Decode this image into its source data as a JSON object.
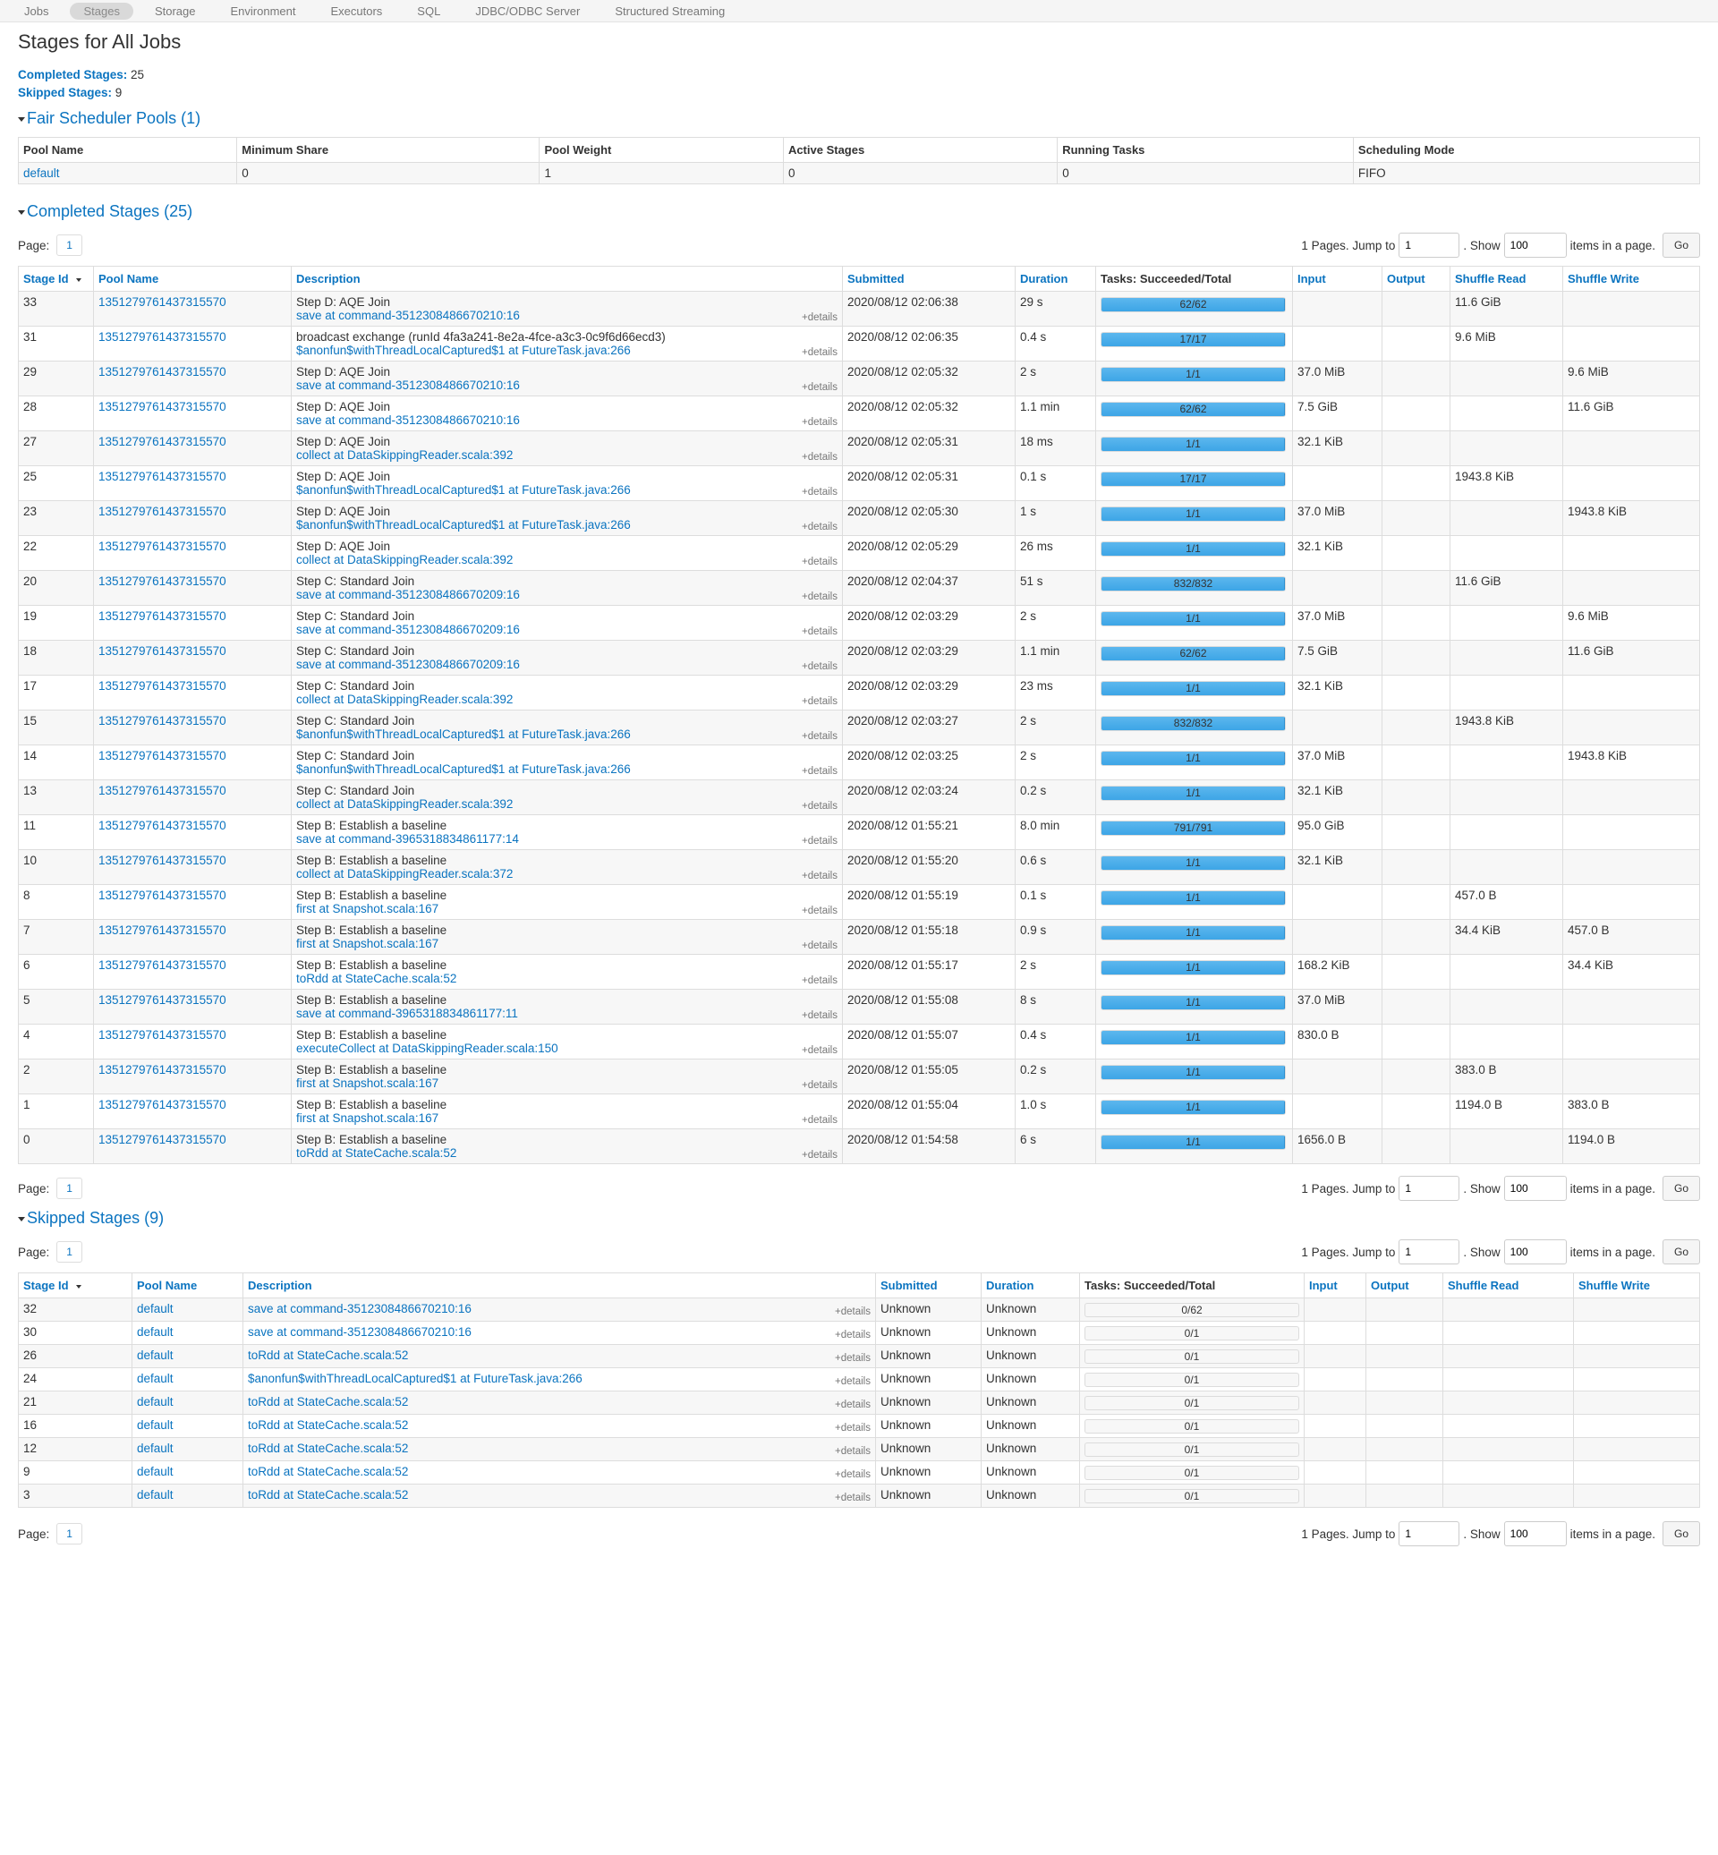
{
  "nav": {
    "tabs": [
      {
        "label": "Jobs",
        "active": false
      },
      {
        "label": "Stages",
        "active": true
      },
      {
        "label": "Storage",
        "active": false
      },
      {
        "label": "Environment",
        "active": false
      },
      {
        "label": "Executors",
        "active": false
      },
      {
        "label": "SQL",
        "active": false
      },
      {
        "label": "JDBC/ODBC Server",
        "active": false
      },
      {
        "label": "Structured Streaming",
        "active": false
      }
    ]
  },
  "page": {
    "title": "Stages for All Jobs",
    "completed_label": "Completed Stages:",
    "completed_count": "25",
    "skipped_label": "Skipped Stages:",
    "skipped_count": "9"
  },
  "pools": {
    "title": "Fair Scheduler Pools (1)",
    "headers": [
      "Pool Name",
      "Minimum Share",
      "Pool Weight",
      "Active Stages",
      "Running Tasks",
      "Scheduling Mode"
    ],
    "rows": [
      {
        "name": "default",
        "min_share": "0",
        "weight": "1",
        "active": "0",
        "running": "0",
        "mode": "FIFO"
      }
    ]
  },
  "pager": {
    "page_label": "Page:",
    "page_num": "1",
    "pages_text": "1 Pages. Jump to",
    "jump_value": "1",
    "show_label": ". Show",
    "show_value": "100",
    "items_text": "items in a page.",
    "go_label": "Go"
  },
  "completed": {
    "title": "Completed Stages (25)",
    "headers": {
      "stage_id": "Stage Id",
      "pool": "Pool Name",
      "desc": "Description",
      "submitted": "Submitted",
      "duration": "Duration",
      "tasks": "Tasks: Succeeded/Total",
      "input": "Input",
      "output": "Output",
      "shuffle_read": "Shuffle Read",
      "shuffle_write": "Shuffle Write"
    },
    "details_label": "+details",
    "rows": [
      {
        "id": "33",
        "pool": "1351279761437315570",
        "d1": "Step D: AQE Join",
        "d2": "save at command-3512308486670210:16",
        "submitted": "2020/08/12 02:06:38",
        "duration": "29 s",
        "tasks": "62/62",
        "progress": 1,
        "input": "",
        "output": "",
        "sread": "11.6 GiB",
        "swrite": ""
      },
      {
        "id": "31",
        "pool": "1351279761437315570",
        "d1": "broadcast exchange (runId 4fa3a241-8e2a-4fce-a3c3-0c9f6d66ecd3)",
        "d2": "$anonfun$withThreadLocalCaptured$1 at FutureTask.java:266",
        "submitted": "2020/08/12 02:06:35",
        "duration": "0.4 s",
        "tasks": "17/17",
        "progress": 1,
        "input": "",
        "output": "",
        "sread": "9.6 MiB",
        "swrite": ""
      },
      {
        "id": "29",
        "pool": "1351279761437315570",
        "d1": "Step D: AQE Join",
        "d2": "save at command-3512308486670210:16",
        "submitted": "2020/08/12 02:05:32",
        "duration": "2 s",
        "tasks": "1/1",
        "progress": 1,
        "input": "37.0 MiB",
        "output": "",
        "sread": "",
        "swrite": "9.6 MiB"
      },
      {
        "id": "28",
        "pool": "1351279761437315570",
        "d1": "Step D: AQE Join",
        "d2": "save at command-3512308486670210:16",
        "submitted": "2020/08/12 02:05:32",
        "duration": "1.1 min",
        "tasks": "62/62",
        "progress": 1,
        "input": "7.5 GiB",
        "output": "",
        "sread": "",
        "swrite": "11.6 GiB"
      },
      {
        "id": "27",
        "pool": "1351279761437315570",
        "d1": "Step D: AQE Join",
        "d2": "collect at DataSkippingReader.scala:392",
        "submitted": "2020/08/12 02:05:31",
        "duration": "18 ms",
        "tasks": "1/1",
        "progress": 1,
        "input": "32.1 KiB",
        "output": "",
        "sread": "",
        "swrite": ""
      },
      {
        "id": "25",
        "pool": "1351279761437315570",
        "d1": "Step D: AQE Join",
        "d2": "$anonfun$withThreadLocalCaptured$1 at FutureTask.java:266",
        "submitted": "2020/08/12 02:05:31",
        "duration": "0.1 s",
        "tasks": "17/17",
        "progress": 1,
        "input": "",
        "output": "",
        "sread": "1943.8 KiB",
        "swrite": ""
      },
      {
        "id": "23",
        "pool": "1351279761437315570",
        "d1": "Step D: AQE Join",
        "d2": "$anonfun$withThreadLocalCaptured$1 at FutureTask.java:266",
        "submitted": "2020/08/12 02:05:30",
        "duration": "1 s",
        "tasks": "1/1",
        "progress": 1,
        "input": "37.0 MiB",
        "output": "",
        "sread": "",
        "swrite": "1943.8 KiB"
      },
      {
        "id": "22",
        "pool": "1351279761437315570",
        "d1": "Step D: AQE Join",
        "d2": "collect at DataSkippingReader.scala:392",
        "submitted": "2020/08/12 02:05:29",
        "duration": "26 ms",
        "tasks": "1/1",
        "progress": 1,
        "input": "32.1 KiB",
        "output": "",
        "sread": "",
        "swrite": ""
      },
      {
        "id": "20",
        "pool": "1351279761437315570",
        "d1": "Step C: Standard Join",
        "d2": "save at command-3512308486670209:16",
        "submitted": "2020/08/12 02:04:37",
        "duration": "51 s",
        "tasks": "832/832",
        "progress": 1,
        "input": "",
        "output": "",
        "sread": "11.6 GiB",
        "swrite": ""
      },
      {
        "id": "19",
        "pool": "1351279761437315570",
        "d1": "Step C: Standard Join",
        "d2": "save at command-3512308486670209:16",
        "submitted": "2020/08/12 02:03:29",
        "duration": "2 s",
        "tasks": "1/1",
        "progress": 1,
        "input": "37.0 MiB",
        "output": "",
        "sread": "",
        "swrite": "9.6 MiB"
      },
      {
        "id": "18",
        "pool": "1351279761437315570",
        "d1": "Step C: Standard Join",
        "d2": "save at command-3512308486670209:16",
        "submitted": "2020/08/12 02:03:29",
        "duration": "1.1 min",
        "tasks": "62/62",
        "progress": 1,
        "input": "7.5 GiB",
        "output": "",
        "sread": "",
        "swrite": "11.6 GiB"
      },
      {
        "id": "17",
        "pool": "1351279761437315570",
        "d1": "Step C: Standard Join",
        "d2": "collect at DataSkippingReader.scala:392",
        "submitted": "2020/08/12 02:03:29",
        "duration": "23 ms",
        "tasks": "1/1",
        "progress": 1,
        "input": "32.1 KiB",
        "output": "",
        "sread": "",
        "swrite": ""
      },
      {
        "id": "15",
        "pool": "1351279761437315570",
        "d1": "Step C: Standard Join",
        "d2": "$anonfun$withThreadLocalCaptured$1 at FutureTask.java:266",
        "submitted": "2020/08/12 02:03:27",
        "duration": "2 s",
        "tasks": "832/832",
        "progress": 1,
        "input": "",
        "output": "",
        "sread": "1943.8 KiB",
        "swrite": ""
      },
      {
        "id": "14",
        "pool": "1351279761437315570",
        "d1": "Step C: Standard Join",
        "d2": "$anonfun$withThreadLocalCaptured$1 at FutureTask.java:266",
        "submitted": "2020/08/12 02:03:25",
        "duration": "2 s",
        "tasks": "1/1",
        "progress": 1,
        "input": "37.0 MiB",
        "output": "",
        "sread": "",
        "swrite": "1943.8 KiB"
      },
      {
        "id": "13",
        "pool": "1351279761437315570",
        "d1": "Step C: Standard Join",
        "d2": "collect at DataSkippingReader.scala:392",
        "submitted": "2020/08/12 02:03:24",
        "duration": "0.2 s",
        "tasks": "1/1",
        "progress": 1,
        "input": "32.1 KiB",
        "output": "",
        "sread": "",
        "swrite": ""
      },
      {
        "id": "11",
        "pool": "1351279761437315570",
        "d1": "Step B: Establish a baseline",
        "d2": "save at command-3965318834861177:14",
        "submitted": "2020/08/12 01:55:21",
        "duration": "8.0 min",
        "tasks": "791/791",
        "progress": 1,
        "input": "95.0 GiB",
        "output": "",
        "sread": "",
        "swrite": ""
      },
      {
        "id": "10",
        "pool": "1351279761437315570",
        "d1": "Step B: Establish a baseline",
        "d2": "collect at DataSkippingReader.scala:372",
        "submitted": "2020/08/12 01:55:20",
        "duration": "0.6 s",
        "tasks": "1/1",
        "progress": 1,
        "input": "32.1 KiB",
        "output": "",
        "sread": "",
        "swrite": ""
      },
      {
        "id": "8",
        "pool": "1351279761437315570",
        "d1": "Step B: Establish a baseline",
        "d2": "first at Snapshot.scala:167",
        "submitted": "2020/08/12 01:55:19",
        "duration": "0.1 s",
        "tasks": "1/1",
        "progress": 1,
        "input": "",
        "output": "",
        "sread": "457.0 B",
        "swrite": ""
      },
      {
        "id": "7",
        "pool": "1351279761437315570",
        "d1": "Step B: Establish a baseline",
        "d2": "first at Snapshot.scala:167",
        "submitted": "2020/08/12 01:55:18",
        "duration": "0.9 s",
        "tasks": "1/1",
        "progress": 1,
        "input": "",
        "output": "",
        "sread": "34.4 KiB",
        "swrite": "457.0 B"
      },
      {
        "id": "6",
        "pool": "1351279761437315570",
        "d1": "Step B: Establish a baseline",
        "d2": "toRdd at StateCache.scala:52",
        "submitted": "2020/08/12 01:55:17",
        "duration": "2 s",
        "tasks": "1/1",
        "progress": 1,
        "input": "168.2 KiB",
        "output": "",
        "sread": "",
        "swrite": "34.4 KiB"
      },
      {
        "id": "5",
        "pool": "1351279761437315570",
        "d1": "Step B: Establish a baseline",
        "d2": "save at command-3965318834861177:11",
        "submitted": "2020/08/12 01:55:08",
        "duration": "8 s",
        "tasks": "1/1",
        "progress": 1,
        "input": "37.0 MiB",
        "output": "",
        "sread": "",
        "swrite": ""
      },
      {
        "id": "4",
        "pool": "1351279761437315570",
        "d1": "Step B: Establish a baseline",
        "d2": "executeCollect at DataSkippingReader.scala:150",
        "submitted": "2020/08/12 01:55:07",
        "duration": "0.4 s",
        "tasks": "1/1",
        "progress": 1,
        "input": "830.0 B",
        "output": "",
        "sread": "",
        "swrite": ""
      },
      {
        "id": "2",
        "pool": "1351279761437315570",
        "d1": "Step B: Establish a baseline",
        "d2": "first at Snapshot.scala:167",
        "submitted": "2020/08/12 01:55:05",
        "duration": "0.2 s",
        "tasks": "1/1",
        "progress": 1,
        "input": "",
        "output": "",
        "sread": "383.0 B",
        "swrite": ""
      },
      {
        "id": "1",
        "pool": "1351279761437315570",
        "d1": "Step B: Establish a baseline",
        "d2": "first at Snapshot.scala:167",
        "submitted": "2020/08/12 01:55:04",
        "duration": "1.0 s",
        "tasks": "1/1",
        "progress": 1,
        "input": "",
        "output": "",
        "sread": "1194.0 B",
        "swrite": "383.0 B"
      },
      {
        "id": "0",
        "pool": "1351279761437315570",
        "d1": "Step B: Establish a baseline",
        "d2": "toRdd at StateCache.scala:52",
        "submitted": "2020/08/12 01:54:58",
        "duration": "6 s",
        "tasks": "1/1",
        "progress": 1,
        "input": "1656.0 B",
        "output": "",
        "sread": "",
        "swrite": "1194.0 B"
      }
    ]
  },
  "skipped": {
    "title": "Skipped Stages (9)",
    "details_label": "+details",
    "rows": [
      {
        "id": "32",
        "pool": "default",
        "desc": "save at command-3512308486670210:16",
        "submitted": "Unknown",
        "duration": "Unknown",
        "tasks": "0/62",
        "progress": 0,
        "input": "",
        "output": "",
        "sread": "",
        "swrite": ""
      },
      {
        "id": "30",
        "pool": "default",
        "desc": "save at command-3512308486670210:16",
        "submitted": "Unknown",
        "duration": "Unknown",
        "tasks": "0/1",
        "progress": 0,
        "input": "",
        "output": "",
        "sread": "",
        "swrite": ""
      },
      {
        "id": "26",
        "pool": "default",
        "desc": "toRdd at StateCache.scala:52",
        "submitted": "Unknown",
        "duration": "Unknown",
        "tasks": "0/1",
        "progress": 0,
        "input": "",
        "output": "",
        "sread": "",
        "swrite": ""
      },
      {
        "id": "24",
        "pool": "default",
        "desc": "$anonfun$withThreadLocalCaptured$1 at FutureTask.java:266",
        "submitted": "Unknown",
        "duration": "Unknown",
        "tasks": "0/1",
        "progress": 0,
        "input": "",
        "output": "",
        "sread": "",
        "swrite": ""
      },
      {
        "id": "21",
        "pool": "default",
        "desc": "toRdd at StateCache.scala:52",
        "submitted": "Unknown",
        "duration": "Unknown",
        "tasks": "0/1",
        "progress": 0,
        "input": "",
        "output": "",
        "sread": "",
        "swrite": ""
      },
      {
        "id": "16",
        "pool": "default",
        "desc": "toRdd at StateCache.scala:52",
        "submitted": "Unknown",
        "duration": "Unknown",
        "tasks": "0/1",
        "progress": 0,
        "input": "",
        "output": "",
        "sread": "",
        "swrite": ""
      },
      {
        "id": "12",
        "pool": "default",
        "desc": "toRdd at StateCache.scala:52",
        "submitted": "Unknown",
        "duration": "Unknown",
        "tasks": "0/1",
        "progress": 0,
        "input": "",
        "output": "",
        "sread": "",
        "swrite": ""
      },
      {
        "id": "9",
        "pool": "default",
        "desc": "toRdd at StateCache.scala:52",
        "submitted": "Unknown",
        "duration": "Unknown",
        "tasks": "0/1",
        "progress": 0,
        "input": "",
        "output": "",
        "sread": "",
        "swrite": ""
      },
      {
        "id": "3",
        "pool": "default",
        "desc": "toRdd at StateCache.scala:52",
        "submitted": "Unknown",
        "duration": "Unknown",
        "tasks": "0/1",
        "progress": 0,
        "input": "",
        "output": "",
        "sread": "",
        "swrite": ""
      }
    ]
  }
}
